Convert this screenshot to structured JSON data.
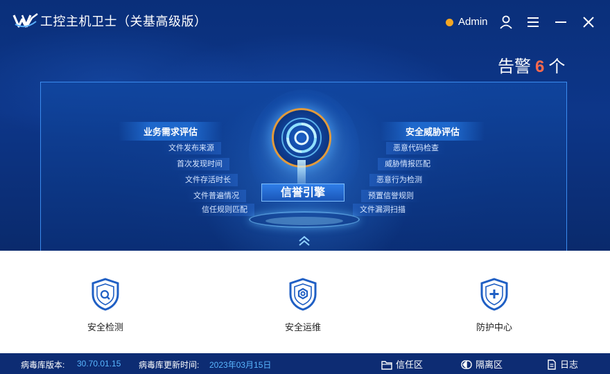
{
  "app": {
    "title": "工控主机卫士（关基高级版）",
    "user": "Admin",
    "status_color": "#f5a623"
  },
  "alert": {
    "prefix": "告警",
    "count": "6",
    "suffix": "个"
  },
  "engine": {
    "label": "信誉引擎",
    "left": {
      "title": "业务需求评估",
      "items": [
        "文件发布来源",
        "首次发现时间",
        "文件存活时长",
        "文件普遍情况",
        "信任规则匹配"
      ]
    },
    "right": {
      "title": "安全威胁评估",
      "items": [
        "恶意代码检查",
        "威胁情报匹配",
        "恶意行为检测",
        "预置信誉规则",
        "文件漏洞扫描"
      ]
    }
  },
  "cards": [
    {
      "label": "安全检测",
      "icon": "shield-search-icon"
    },
    {
      "label": "安全运维",
      "icon": "shield-gear-icon"
    },
    {
      "label": "防护中心",
      "icon": "shield-plus-icon"
    }
  ],
  "footer": {
    "db_version_label": "病毒库版本:",
    "db_version": "30.70.01.15",
    "db_update_label": "病毒库更新时间:",
    "db_update": "2023年03月15日",
    "trust_zone": "信任区",
    "quarantine": "隔离区",
    "log": "日志"
  },
  "colors": {
    "accent": "#1f5fc4",
    "alert_count": "#ff6a4d",
    "footer_value": "#59b6ff"
  }
}
